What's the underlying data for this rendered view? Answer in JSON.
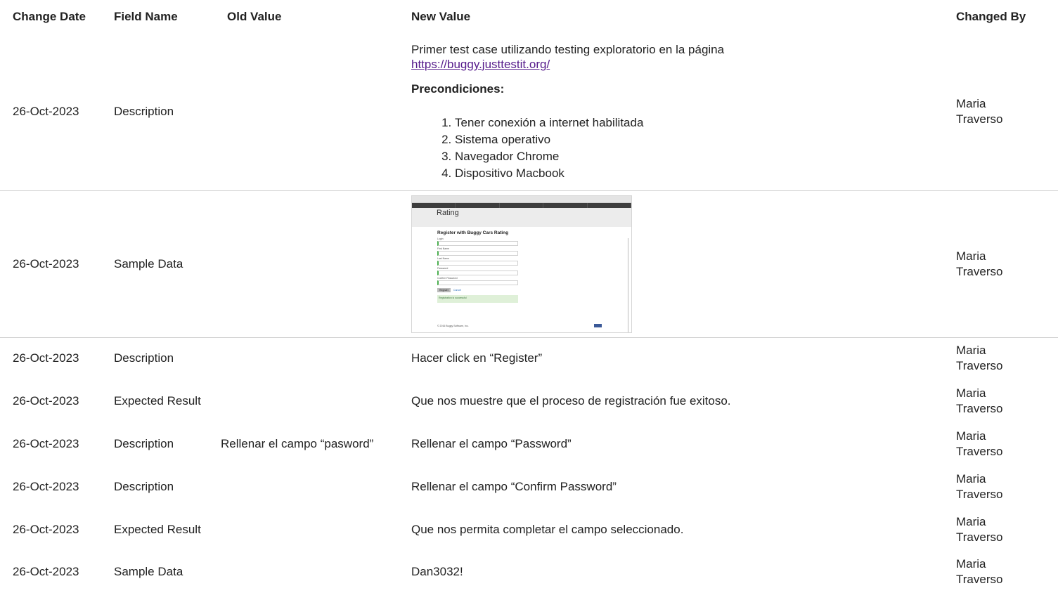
{
  "headers": {
    "change_date": "Change Date",
    "field_name": "Field Name",
    "old_value": "Old Value",
    "new_value": "New Value",
    "changed_by": "Changed By"
  },
  "rows": [
    {
      "date": "26-Oct-2023",
      "field": "Description",
      "old": "",
      "new_intro": "Primer test case utilizando testing exploratorio en la página",
      "new_link": "https://buggy.justtestit.org/",
      "new_heading": "Precondiciones:",
      "new_list": [
        "Tener conexión a internet habilitada",
        "Sistema operativo",
        "Navegador Chrome",
        "Dispositivo Macbook"
      ],
      "by_first": "Maria",
      "by_last": "Traverso"
    },
    {
      "date": "26-Oct-2023",
      "field": "Sample Data",
      "old": "",
      "screenshot": {
        "banner_text": "Rating",
        "form_title": "Register with Buggy Cars Rating",
        "labels": [
          "Login",
          "First Name",
          "Last Name",
          "Password",
          "Confirm Password"
        ],
        "register_label": "Register",
        "cancel_label": "Cancel",
        "success_text": "Registration is successful",
        "footer_text": "© 2016 Buggy Software, Inc."
      },
      "by_first": "Maria",
      "by_last": "Traverso"
    },
    {
      "date": "26-Oct-2023",
      "field": "Description",
      "old": "",
      "new": "Hacer click en “Register”",
      "by_first": "Maria",
      "by_last": "Traverso"
    },
    {
      "date": "26-Oct-2023",
      "field": "Expected Result",
      "old": "",
      "new": "Que nos muestre que el proceso de registración fue exitoso.",
      "by_first": "Maria",
      "by_last": "Traverso"
    },
    {
      "date": "26-Oct-2023",
      "field": "Description",
      "old": "Rellenar el campo “pasword”",
      "new": "Rellenar el campo “Password”",
      "by_first": "Maria",
      "by_last": "Traverso"
    },
    {
      "date": "26-Oct-2023",
      "field": "Description",
      "old": "",
      "new": "Rellenar el campo “Confirm Password”",
      "by_first": "Maria",
      "by_last": "Traverso"
    },
    {
      "date": "26-Oct-2023",
      "field": "Expected Result",
      "old": "",
      "new": "Que nos permita completar el campo seleccionado.",
      "by_first": "Maria",
      "by_last": "Traverso"
    },
    {
      "date": "26-Oct-2023",
      "field": "Sample Data",
      "old": "",
      "new": "Dan3032!",
      "by_first": "Maria",
      "by_last": "Traverso"
    }
  ]
}
